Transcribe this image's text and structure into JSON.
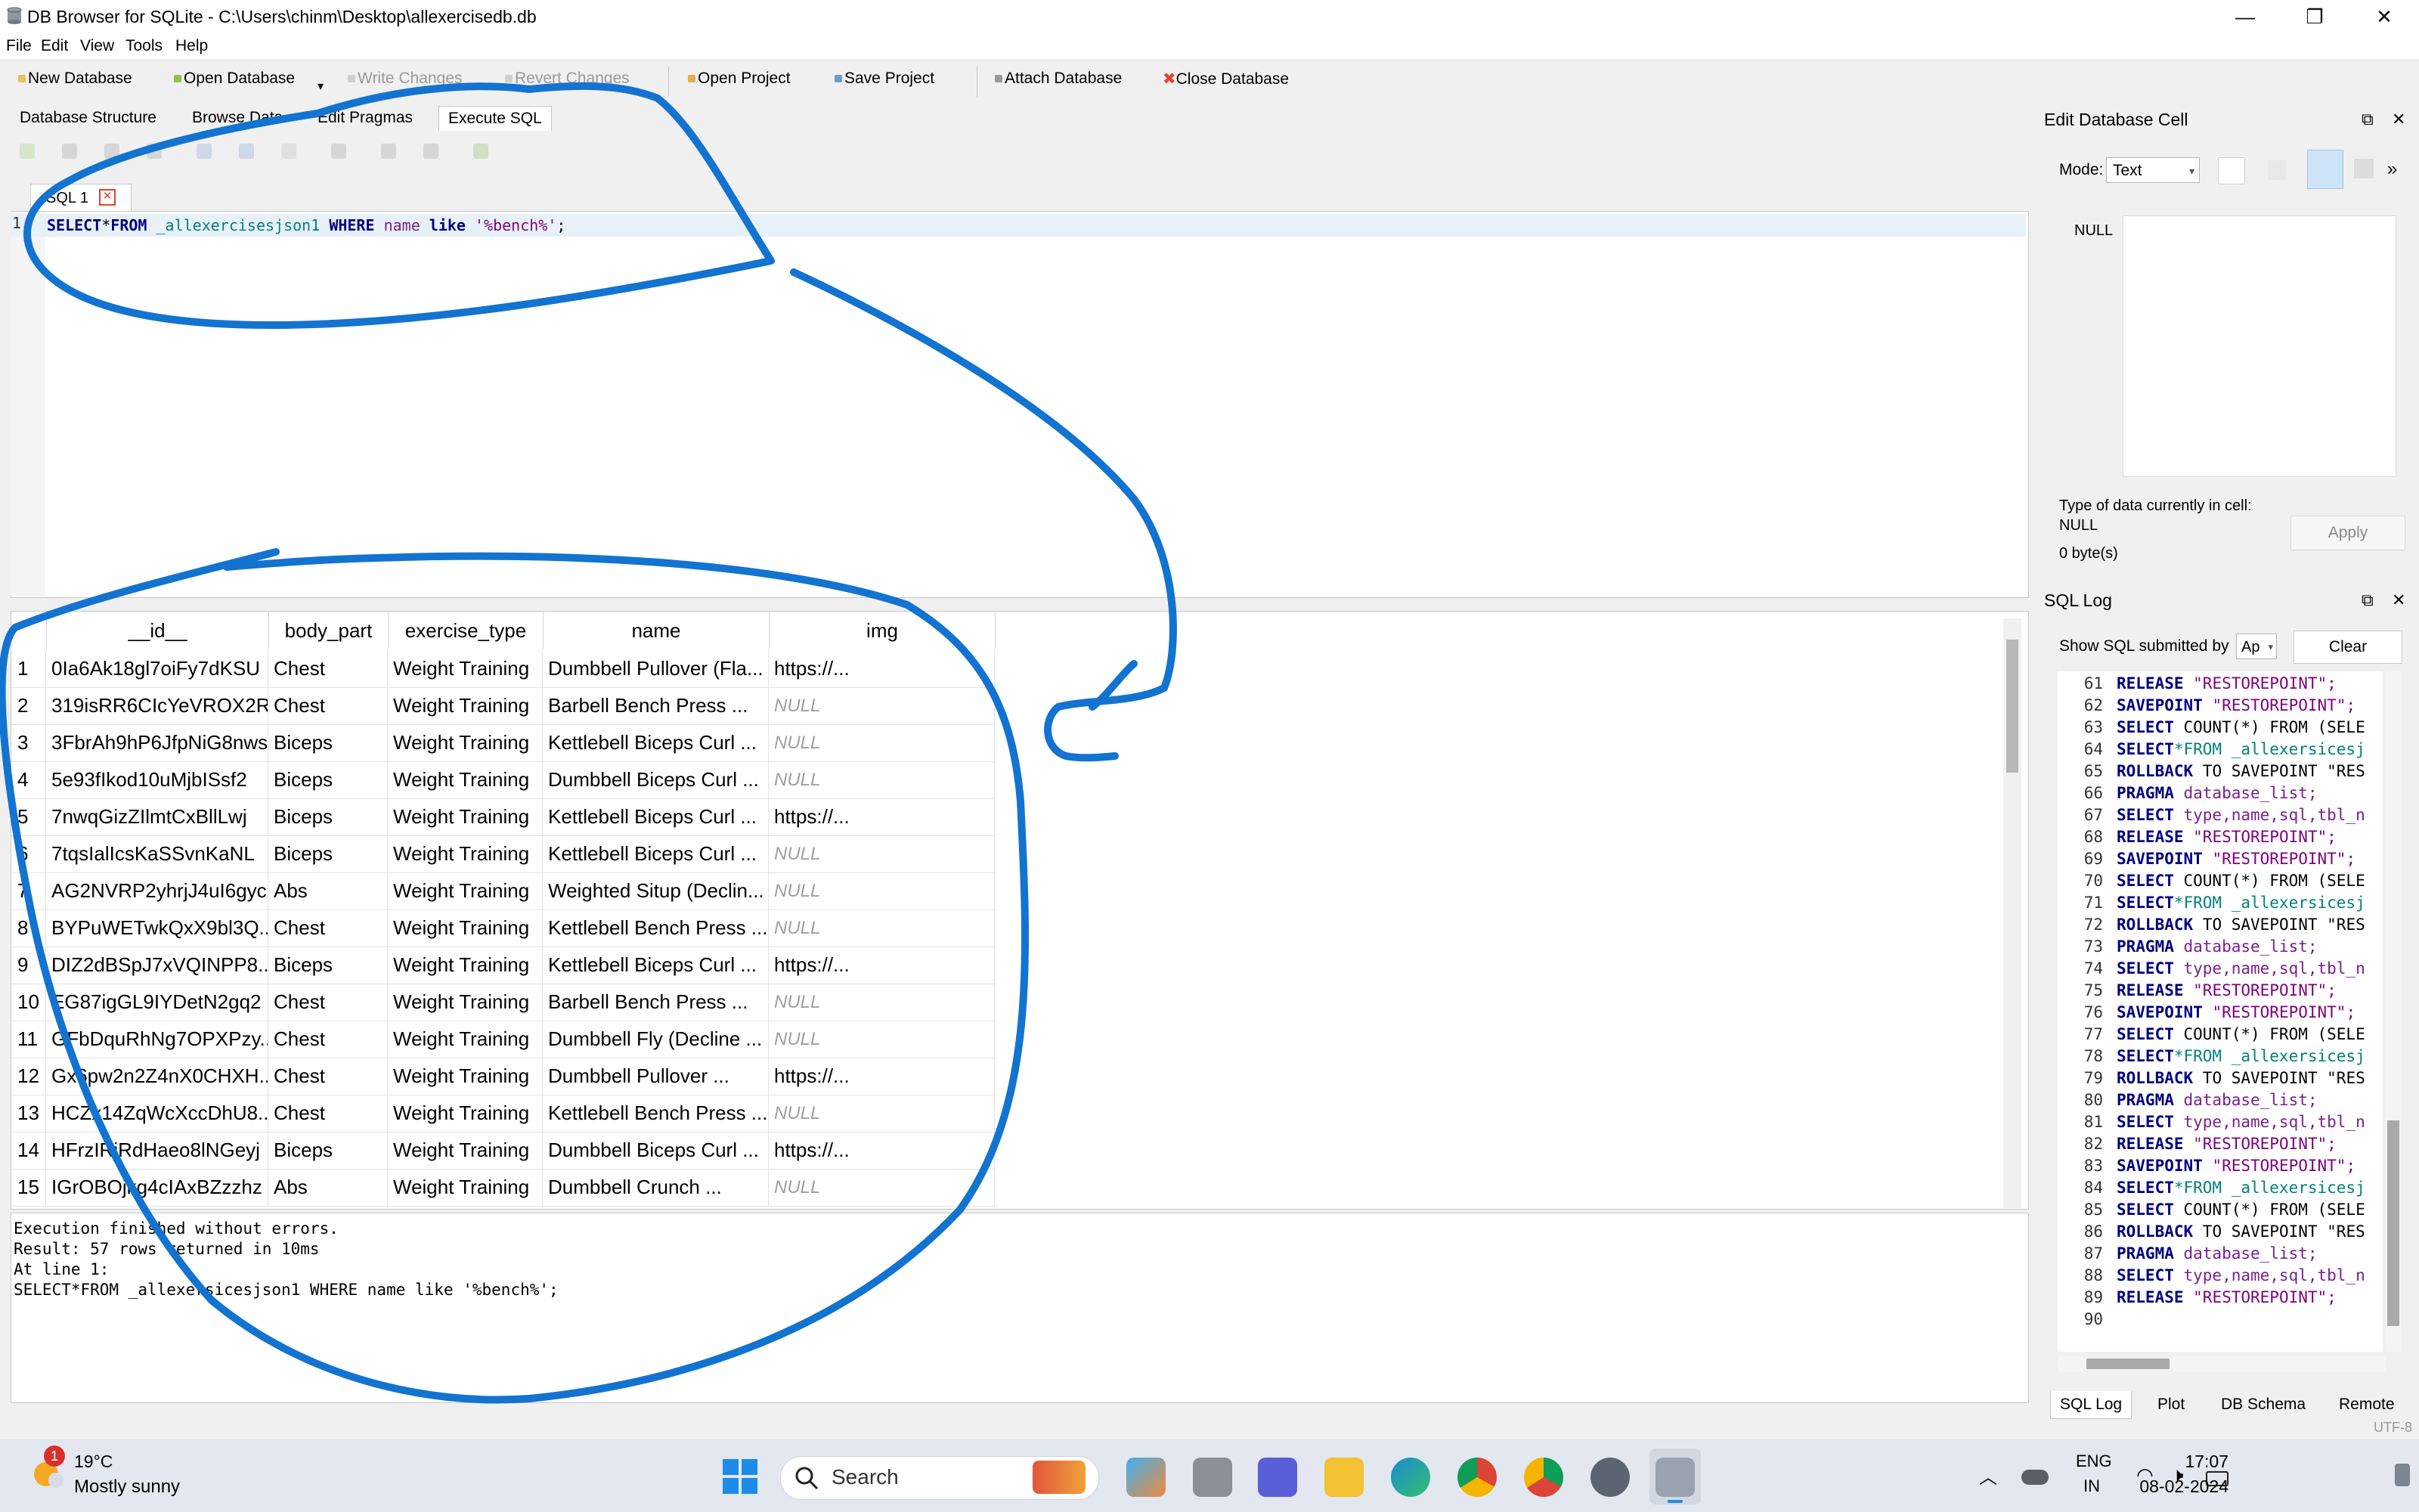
{
  "window": {
    "title": "DB Browser for SQLite - C:\\Users\\chinm\\Desktop\\allexercisedb.db",
    "minimize_glyph": "—",
    "maximize_glyph": "❐",
    "close_glyph": "✕"
  },
  "menu": [
    "File",
    "Edit",
    "View",
    "Tools",
    "Help"
  ],
  "toolbar": {
    "new_database": "New Database",
    "open_database": "Open Database",
    "write_changes": "Write Changes",
    "revert_changes": "Revert Changes",
    "open_project": "Open Project",
    "save_project": "Save Project",
    "attach_database": "Attach Database",
    "close_database": "Close Database"
  },
  "tabs": [
    "Database Structure",
    "Browse Data",
    "Edit Pragmas",
    "Execute SQL"
  ],
  "editor": {
    "tab_label": "SQL 1",
    "line_number": "1",
    "query": {
      "kw_select": "SELECT",
      "star": "*",
      "kw_from": "FROM",
      "table": "_allexercisesjson1",
      "kw_where": "WHERE",
      "column": "name",
      "kw_like": "like",
      "pattern": "'%bench%'",
      "end": ";"
    }
  },
  "results": {
    "columns": [
      "__id__",
      "body_part",
      "exercise_type",
      "name",
      "img"
    ],
    "rows": [
      [
        "1",
        "0Ia6Ak18gl7oiFy7dKSU",
        "Chest",
        "Weight Training",
        "Dumbbell Pullover (Fla...",
        "https://..."
      ],
      [
        "2",
        "319isRR6CIcYeVROX2Rs",
        "Chest",
        "Weight Training",
        "Barbell Bench Press ...",
        "NULL"
      ],
      [
        "3",
        "3FbrAh9hP6JfpNiG8nws",
        "Biceps",
        "Weight Training",
        "Kettlebell Biceps Curl ...",
        "NULL"
      ],
      [
        "4",
        "5e93fIkod10uMjbISsf2",
        "Biceps",
        "Weight Training",
        "Dumbbell Biceps Curl ...",
        "NULL"
      ],
      [
        "5",
        "7nwqGizZIlmtCxBllLwj",
        "Biceps",
        "Weight Training",
        "Kettlebell Biceps Curl ...",
        "https://..."
      ],
      [
        "6",
        "7tqsIalIcsKaSSvnKaNL",
        "Biceps",
        "Weight Training",
        "Kettlebell Biceps Curl ...",
        "NULL"
      ],
      [
        "7",
        "AG2NVRP2yhrjJ4uI6gyc",
        "Abs",
        "Weight Training",
        "Weighted Situp (Declin...",
        "NULL"
      ],
      [
        "8",
        "BYPuWETwkQxX9bl3Q...",
        "Chest",
        "Weight Training",
        "Kettlebell Bench Press ...",
        "NULL"
      ],
      [
        "9",
        "DIZ2dBSpJ7xVQINPP8...",
        "Biceps",
        "Weight Training",
        "Kettlebell Biceps Curl ...",
        "https://..."
      ],
      [
        "10",
        "EG87igGL9IYDetN2gq2",
        "Chest",
        "Weight Training",
        "Barbell Bench Press ...",
        "NULL"
      ],
      [
        "11",
        "GFbDquRhNg7OPXPzy...",
        "Chest",
        "Weight Training",
        "Dumbbell Fly (Decline ...",
        "NULL"
      ],
      [
        "12",
        "Gx6pw2n2Z4nX0CHXH...",
        "Chest",
        "Weight Training",
        "Dumbbell Pullover ...",
        "https://..."
      ],
      [
        "13",
        "HCZx14ZqWcXccDhU8...",
        "Chest",
        "Weight Training",
        "Kettlebell Bench Press ...",
        "NULL"
      ],
      [
        "14",
        "HFrzIRjRdHaeo8lNGeyj",
        "Biceps",
        "Weight Training",
        "Dumbbell Biceps Curl ...",
        "https://..."
      ],
      [
        "15",
        "IGrOBOjkg4cIAxBZzzhz",
        "Abs",
        "Weight Training",
        "Dumbbell Crunch ...",
        "NULL"
      ]
    ]
  },
  "messages": [
    "Execution finished without errors.",
    "Result: 57 rows returned in 10ms",
    "At line 1:",
    "SELECT*FROM _allexersicesjson1 WHERE name like '%bench%';"
  ],
  "edit_cell": {
    "title": "Edit Database Cell",
    "mode_label": "Mode:",
    "mode_value": "Text",
    "null_label": "NULL",
    "type_label": "Type of data currently in cell:",
    "type_value": "NULL",
    "size_label": "0 byte(s)",
    "apply": "Apply",
    "more": "»"
  },
  "sql_log": {
    "title": "SQL Log",
    "show_label": "Show SQL submitted by",
    "show_value": "Ap",
    "clear": "Clear",
    "lines": [
      {
        "n": "61",
        "kw": "RELEASE",
        "rest": " \"RESTOREPOINT\";",
        "style": "str"
      },
      {
        "n": "62",
        "kw": "SAVEPOINT",
        "rest": " \"RESTOREPOINT\";",
        "style": "str"
      },
      {
        "n": "63",
        "kw": "SELECT",
        "rest": " COUNT(*) FROM (SELE",
        "style": "kw"
      },
      {
        "n": "64",
        "kw": "SELECT",
        "rest": "*FROM _allexersicesj",
        "style": "tbl"
      },
      {
        "n": "65",
        "kw": "ROLLBACK",
        "rest": " TO SAVEPOINT \"RES",
        "style": "kw"
      },
      {
        "n": "66",
        "kw": "PRAGMA",
        "rest": " database_list;",
        "style": "col"
      },
      {
        "n": "67",
        "kw": "SELECT",
        "rest": " type,name,sql,tbl_n",
        "style": "col"
      },
      {
        "n": "68",
        "kw": "RELEASE",
        "rest": " \"RESTOREPOINT\";",
        "style": "str"
      },
      {
        "n": "69",
        "kw": "SAVEPOINT",
        "rest": " \"RESTOREPOINT\";",
        "style": "str"
      },
      {
        "n": "70",
        "kw": "SELECT",
        "rest": " COUNT(*) FROM (SELE",
        "style": "kw"
      },
      {
        "n": "71",
        "kw": "SELECT",
        "rest": "*FROM _allexersicesj",
        "style": "tbl"
      },
      {
        "n": "72",
        "kw": "ROLLBACK",
        "rest": " TO SAVEPOINT \"RES",
        "style": "kw"
      },
      {
        "n": "73",
        "kw": "PRAGMA",
        "rest": " database_list;",
        "style": "col"
      },
      {
        "n": "74",
        "kw": "SELECT",
        "rest": " type,name,sql,tbl_n",
        "style": "col"
      },
      {
        "n": "75",
        "kw": "RELEASE",
        "rest": " \"RESTOREPOINT\";",
        "style": "str"
      },
      {
        "n": "76",
        "kw": "SAVEPOINT",
        "rest": " \"RESTOREPOINT\";",
        "style": "str"
      },
      {
        "n": "77",
        "kw": "SELECT",
        "rest": " COUNT(*) FROM (SELE",
        "style": "kw"
      },
      {
        "n": "78",
        "kw": "SELECT",
        "rest": "*FROM _allexersicesj",
        "style": "tbl"
      },
      {
        "n": "79",
        "kw": "ROLLBACK",
        "rest": " TO SAVEPOINT \"RES",
        "style": "kw"
      },
      {
        "n": "80",
        "kw": "PRAGMA",
        "rest": " database_list;",
        "style": "col"
      },
      {
        "n": "81",
        "kw": "SELECT",
        "rest": " type,name,sql,tbl_n",
        "style": "col"
      },
      {
        "n": "82",
        "kw": "RELEASE",
        "rest": " \"RESTOREPOINT\";",
        "style": "str"
      },
      {
        "n": "83",
        "kw": "SAVEPOINT",
        "rest": " \"RESTOREPOINT\";",
        "style": "str"
      },
      {
        "n": "84",
        "kw": "SELECT",
        "rest": "*FROM _allexersicesj",
        "style": "tbl"
      },
      {
        "n": "85",
        "kw": "SELECT",
        "rest": " COUNT(*) FROM (SELE",
        "style": "kw"
      },
      {
        "n": "86",
        "kw": "ROLLBACK",
        "rest": " TO SAVEPOINT \"RES",
        "style": "kw"
      },
      {
        "n": "87",
        "kw": "PRAGMA",
        "rest": " database_list;",
        "style": "col"
      },
      {
        "n": "88",
        "kw": "SELECT",
        "rest": " type,name,sql,tbl_n",
        "style": "col"
      },
      {
        "n": "89",
        "kw": "RELEASE",
        "rest": " \"RESTOREPOINT\";",
        "style": "str"
      },
      {
        "n": "90",
        "kw": "",
        "rest": "",
        "style": "kw"
      }
    ]
  },
  "dock_tabs": [
    "SQL Log",
    "Plot",
    "DB Schema",
    "Remote"
  ],
  "encoding": "UTF-8",
  "taskbar": {
    "weather_temp": "19°C",
    "weather_desc": "Mostly sunny",
    "weather_badge": "1",
    "search": "Search",
    "lang_top": "ENG",
    "lang_bottom": "IN",
    "time": "17:07",
    "date": "08-02-2024"
  },
  "colors": {
    "annotation": "#1273d0",
    "keyword": "#00007f",
    "string": "#7f007f",
    "table": "#00807f",
    "null": "#a0a0a0"
  }
}
